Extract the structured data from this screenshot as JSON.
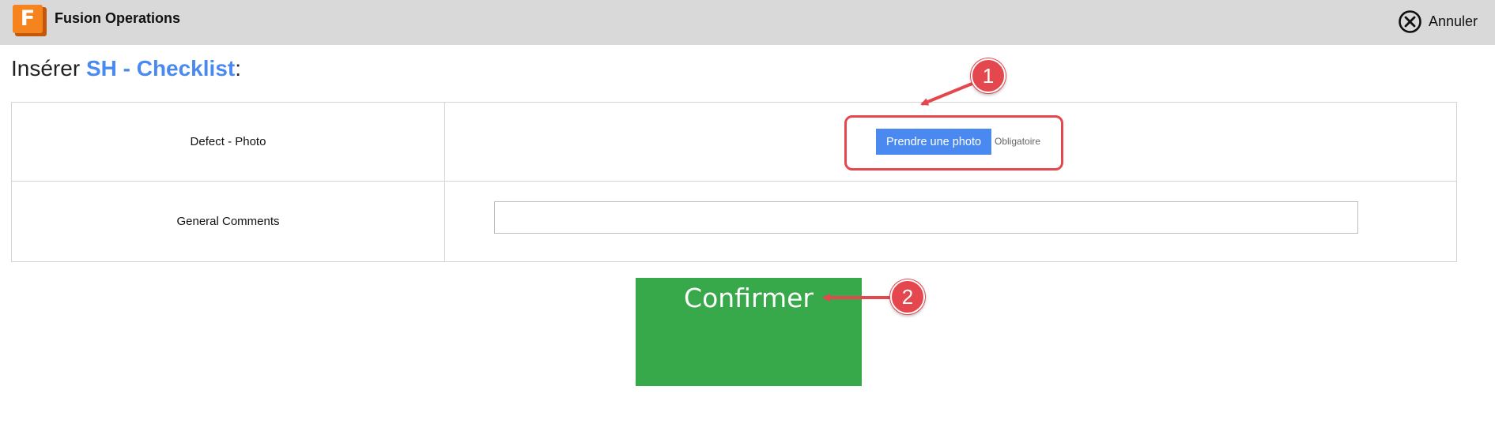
{
  "app": {
    "title": "Fusion Operations",
    "logo_letter": "F"
  },
  "header": {
    "cancel_label": "Annuler"
  },
  "heading": {
    "prefix": "Insérer ",
    "name": "SH - Checklist",
    "suffix": ":"
  },
  "form": {
    "rows": [
      {
        "label": "Defect - Photo",
        "button_label": "Prendre une photo",
        "required_label": "Obligatoire"
      },
      {
        "label": "General Comments",
        "value": ""
      }
    ]
  },
  "confirm": {
    "label": "Confirmer"
  },
  "annotations": [
    {
      "number": "1"
    },
    {
      "number": "2"
    }
  ],
  "colors": {
    "accent": "#4a8af0",
    "confirm": "#37a94a",
    "annotation": "#e4474d",
    "logo": "#f5841f",
    "topbar": "#d9d9d9"
  }
}
